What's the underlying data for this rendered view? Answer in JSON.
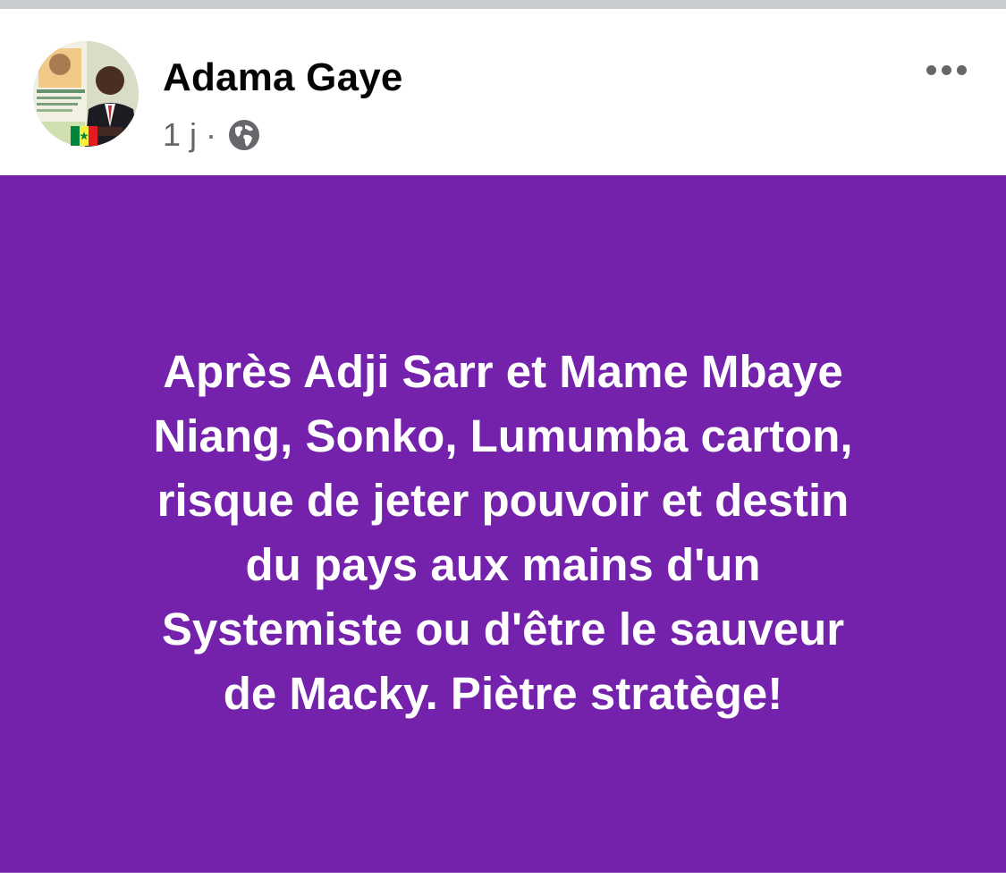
{
  "post": {
    "author": "Adama Gaye",
    "time": "1 j",
    "separator": "·",
    "privacy_icon": "globe-icon",
    "more_icon": "more-horizontal-icon",
    "avatar_icon": "profile-photo",
    "avatar_badge": "senegal-flag-icon",
    "card_background": "#7422ac",
    "text_lines": [
      "Après Adji Sarr et Mame Mbaye",
      "Niang, Sonko, Lumumba carton,",
      "risque de jeter pouvoir et destin",
      "du pays aux mains d'un",
      "Systemiste ou d'être le sauveur",
      "de Macky. Piètre stratège!"
    ]
  },
  "colors": {
    "name": "#050505",
    "meta": "#65676b",
    "card_text": "#ffffff"
  }
}
